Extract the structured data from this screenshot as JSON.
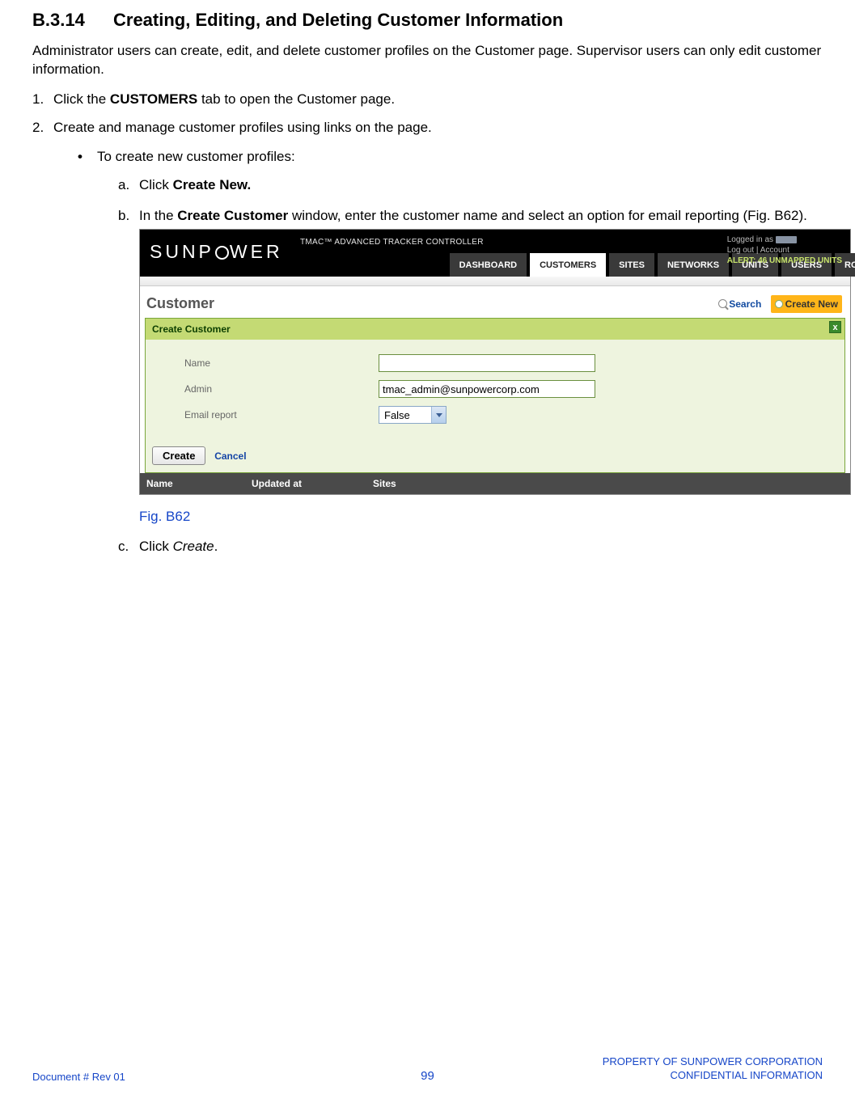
{
  "doc": {
    "section_number": "B.3.14",
    "section_title": "Creating, Editing, and Deleting Customer Information",
    "intro": "Administrator users can create, edit, and delete customer profiles on the Customer page. Supervisor users can only edit customer information.",
    "step1_prefix": "Click the ",
    "step1_bold": "CUSTOMERS",
    "step1_suffix": " tab to open the Customer page.",
    "step2": "Create and manage customer profiles using links on the page.",
    "bullet1": "To create new customer profiles:",
    "step_a_prefix": "Click ",
    "step_a_bold": "Create New.",
    "step_b_prefix": "In the ",
    "step_b_bold": "Create Customer",
    "step_b_suffix": " window, enter the customer name and select an option for email reporting (Fig. B62).",
    "fig_caption": "Fig. B62",
    "step_c_prefix": "Click ",
    "step_c_italic": "Create",
    "step_c_suffix": "."
  },
  "app": {
    "logo_left": "SUNP",
    "logo_right": "WER",
    "title_small": "TMAC™ ADVANCED TRACKER CONTROLLER",
    "header": {
      "logged_in_prefix": "Logged in as ",
      "logout": "Log out",
      "sep": " | ",
      "account": "Account",
      "alert": "ALERT: 46 UNMAPPED UNITS"
    },
    "tabs": {
      "dashboard": "DASHBOARD",
      "customers": "CUSTOMERS",
      "sites": "SITES",
      "networks": "NETWORKS",
      "units": "UNITS",
      "users": "USERS",
      "roles": "ROLES"
    },
    "page_title": "Customer",
    "actions": {
      "search": "Search",
      "create_new": "Create New"
    },
    "dialog": {
      "title": "Create Customer",
      "close": "x",
      "name_label": "Name",
      "name_value": "",
      "admin_label": "Admin",
      "admin_value": "tmac_admin@sunpowercorp.com",
      "email_label": "Email report",
      "email_value": "False",
      "create_btn": "Create",
      "cancel": "Cancel"
    },
    "table": {
      "name": "Name",
      "updated": "Updated at",
      "sites": "Sites"
    }
  },
  "footer": {
    "left": "Document #  Rev 01",
    "mid": "99",
    "right1": "PROPERTY OF SUNPOWER CORPORATION",
    "right2": "CONFIDENTIAL INFORMATION"
  }
}
